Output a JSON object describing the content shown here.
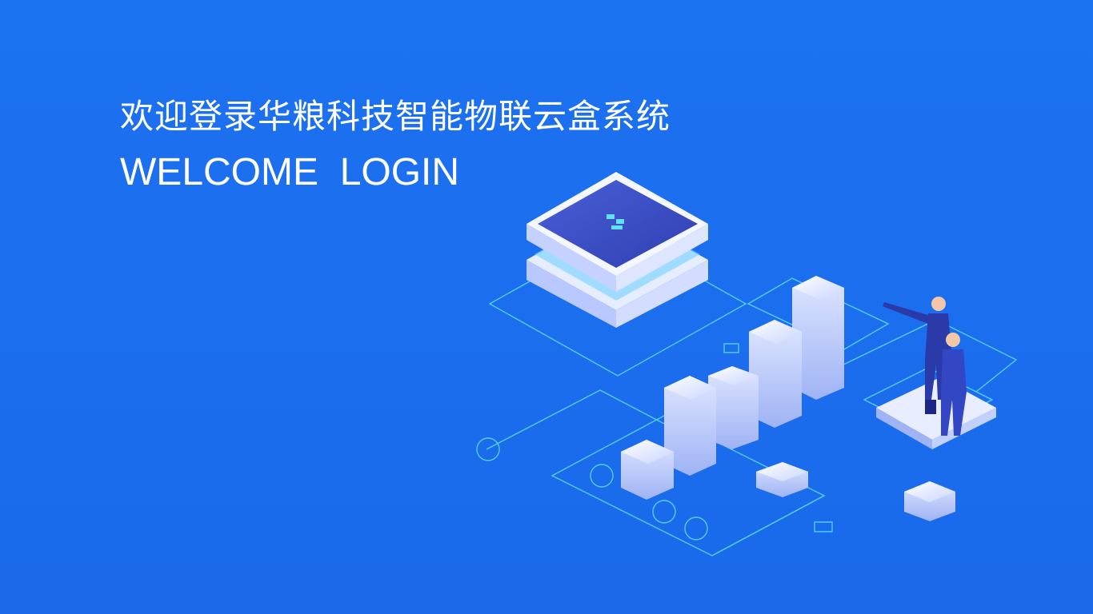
{
  "header": {
    "title_zh": "欢迎登录华粮科技智能物联云盒系统",
    "title_en": "WELCOME  LOGIN"
  },
  "illustration": {
    "icon": "iot-cloud-box-illustration",
    "colors": {
      "background": "#1a6ef0",
      "accent_line": "#5ee0ff",
      "chip_top": "#3d4fc7",
      "block_face": "#eef2ff",
      "people_suit": "#2a3aa8"
    }
  }
}
